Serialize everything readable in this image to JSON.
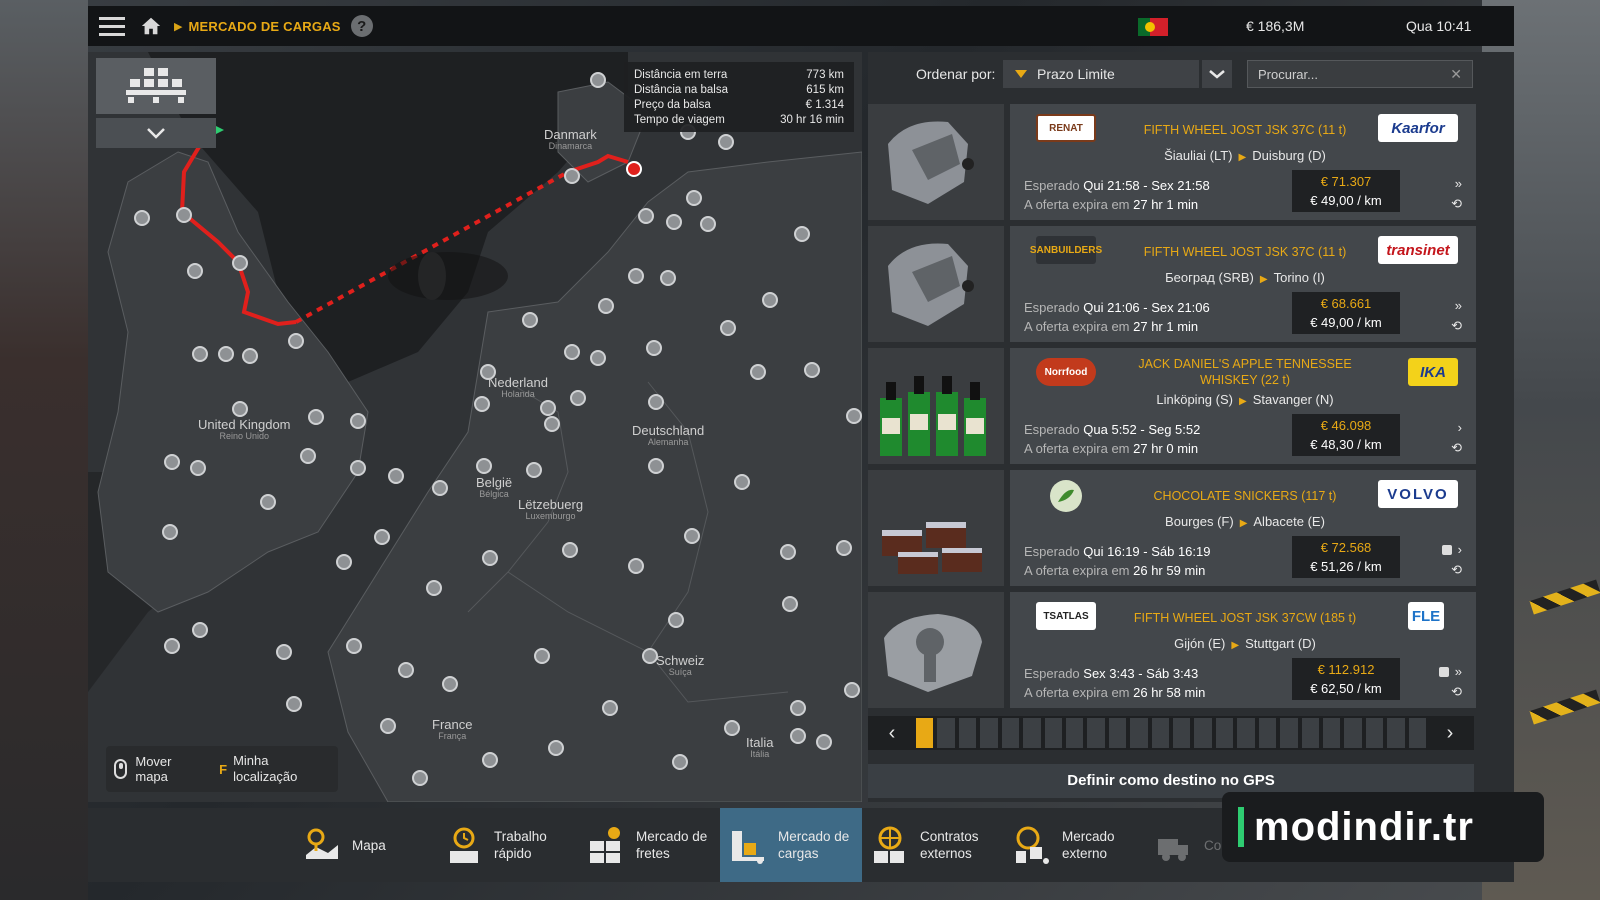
{
  "topbar": {
    "breadcrumb": "MERCADO DE CARGAS",
    "help": "?",
    "money": "€ 186,3M",
    "time": "Qua 10:41"
  },
  "map": {
    "info": [
      {
        "label": "Distância em terra",
        "value": "773 km"
      },
      {
        "label": "Distância na balsa",
        "value": "615 km"
      },
      {
        "label": "Preço da balsa",
        "value": "€ 1.314"
      },
      {
        "label": "Tempo de viagem",
        "value": "30 hr 16 min"
      }
    ],
    "countries": [
      {
        "name": "Danmark",
        "sub": "Dinamarca"
      },
      {
        "name": "United Kingdom",
        "sub": "Reino Unido"
      },
      {
        "name": "Nederland",
        "sub": "Holanda"
      },
      {
        "name": "Deutschland",
        "sub": "Alemanha"
      },
      {
        "name": "België",
        "sub": "Bélgica"
      },
      {
        "name": "Lëtzebuerg",
        "sub": "Luxemburgo"
      },
      {
        "name": "Schweiz",
        "sub": "Suíça"
      },
      {
        "name": "France",
        "sub": "França"
      },
      {
        "name": "Italia",
        "sub": "Itália"
      }
    ],
    "hint_move": "Mover mapa",
    "hint_key": "F",
    "hint_location": "Minha localização"
  },
  "sort": {
    "label": "Ordenar por:",
    "value": "Prazo Limite",
    "search_placeholder": "Procurar..."
  },
  "offers": [
    {
      "company_left": "RENAT",
      "company_right": "Kaarfor",
      "cargo": "FIFTH WHEEL JOST JSK 37C (11 t)",
      "from": "Šiauliai (LT)",
      "to": "Duisburg (D)",
      "expected_label": "Esperado",
      "expected": "Qui 21:58 - Sex 21:58",
      "expires_label": "A oferta expira em",
      "expires": "27 hr 1 min",
      "price": "€ 71.307",
      "per_km": "€ 49,00 / km",
      "icons": "»",
      "locked": false
    },
    {
      "company_left": "SANBUILDERS",
      "company_right": "transinet",
      "cargo": "FIFTH WHEEL JOST JSK 37C (11 t)",
      "from": "Београд (SRB)",
      "to": "Torino (I)",
      "expected_label": "Esperado",
      "expected": "Qui 21:06 - Sex 21:06",
      "expires_label": "A oferta expira em",
      "expires": "27 hr 1 min",
      "price": "€ 68.661",
      "per_km": "€ 49,00 / km",
      "icons": "»",
      "locked": false
    },
    {
      "company_left": "Norrfood",
      "company_right": "IKA",
      "cargo": "JACK DANIEL'S APPLE TENNESSEE WHISKEY (22 t)",
      "from": "Linköping (S)",
      "to": "Stavanger (N)",
      "expected_label": "Esperado",
      "expected": "Qua 5:52 - Seg 5:52",
      "expires_label": "A oferta expira em",
      "expires": "27 hr 0 min",
      "price": "€ 46.098",
      "per_km": "€ 48,30 / km",
      "icons": "›",
      "locked": false
    },
    {
      "company_left": "",
      "company_right": "VOLVO",
      "cargo": "CHOCOLATE SNICKERS (117 t)",
      "from": "Bourges (F)",
      "to": "Albacete (E)",
      "expected_label": "Esperado",
      "expected": "Qui 16:19 - Sáb 16:19",
      "expires_label": "A oferta expira em",
      "expires": "26 hr 59 min",
      "price": "€ 72.568",
      "per_km": "€ 51,26 / km",
      "icons": "›",
      "locked": true
    },
    {
      "company_left": "TSATLAS",
      "company_right": "FLE",
      "cargo": "FIFTH WHEEL JOST JSK 37CW (185 t)",
      "from": "Gijón (E)",
      "to": "Stuttgart (D)",
      "expected_label": "Esperado",
      "expected": "Sex 3:43 - Sáb 3:43",
      "expires_label": "A oferta expira em",
      "expires": "26 hr 58 min",
      "price": "€ 112.912",
      "per_km": "€ 62,50 / km",
      "icons": "»",
      "locked": true
    }
  ],
  "pager": {
    "pages": 24,
    "active": 1
  },
  "gps_button": "Definir como destino no GPS",
  "bottom_nav": [
    {
      "label": "Mapa",
      "icon": "map-icon",
      "active": false
    },
    {
      "label": "Trabalho rápido",
      "icon": "clock-icon",
      "active": false
    },
    {
      "label": "Mercado de fretes",
      "icon": "freight-icon",
      "active": false
    },
    {
      "label": "Mercado de cargas",
      "icon": "cargo-icon",
      "active": true
    },
    {
      "label": "Contratos externos",
      "icon": "globe-icon",
      "active": false
    },
    {
      "label": "Mercado externo",
      "icon": "globe-cargo-icon",
      "active": false
    },
    {
      "label": "Com... ativo",
      "icon": "truck-icon",
      "active": false
    }
  ],
  "watermark": "modindir.tr",
  "colors": {
    "accent": "#e8a915",
    "active_tab": "#3e6a86",
    "route": "#e0201c"
  }
}
